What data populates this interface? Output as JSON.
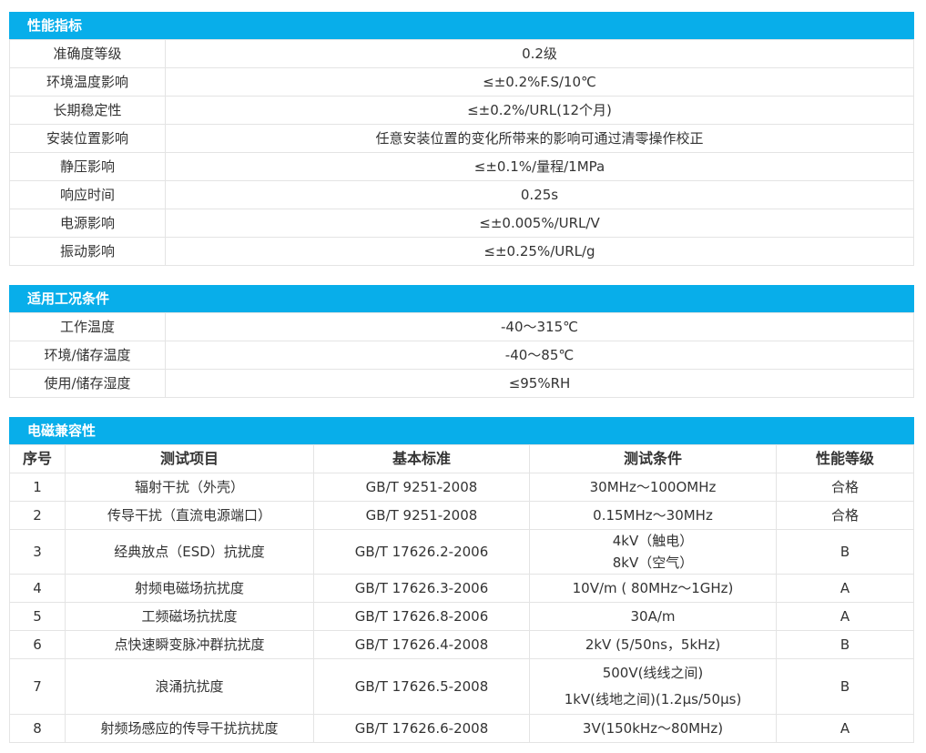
{
  "performance": {
    "title": "性能指标",
    "rows": [
      {
        "label": "准确度等级",
        "value": "0.2级"
      },
      {
        "label": "环境温度影响",
        "value": "≤±0.2%F.S/10℃"
      },
      {
        "label": "长期稳定性",
        "value": "≤±0.2%/URL(12个月)"
      },
      {
        "label": "安装位置影响",
        "value": "任意安装位置的变化所带来的影响可通过清零操作校正"
      },
      {
        "label": "静压影响",
        "value": "≤±0.1%/量程/1MPa"
      },
      {
        "label": "响应时间",
        "value": "0.25s"
      },
      {
        "label": "电源影响",
        "value": "≤±0.005%/URL/V"
      },
      {
        "label": "振动影响",
        "value": "≤±0.25%/URL/g"
      }
    ]
  },
  "conditions": {
    "title": "适用工况条件",
    "rows": [
      {
        "label": "工作温度",
        "value": "-40～315℃"
      },
      {
        "label": "环境/储存温度",
        "value": "-40～85℃"
      },
      {
        "label": "使用/储存湿度",
        "value": "≤95%RH"
      }
    ]
  },
  "emc": {
    "title": "电磁兼容性",
    "headers": [
      "序号",
      "测试项目",
      "基本标准",
      "测试条件",
      "性能等级"
    ],
    "rows": [
      {
        "no": "1",
        "item": "辐射干扰（外壳）",
        "standard": "GB/T 9251-2008",
        "cond": [
          "30MHz～100OMHz"
        ],
        "grade": "合格"
      },
      {
        "no": "2",
        "item": "传导干扰（直流电源端口）",
        "standard": "GB/T 9251-2008",
        "cond": [
          "0.15MHz～30MHz"
        ],
        "grade": "合格"
      },
      {
        "no": "3",
        "item": "经典放点（ESD）抗扰度",
        "standard": "GB/T 17626.2-2006",
        "cond": [
          "4kV（触电）",
          "8kV（空气）"
        ],
        "grade": "B"
      },
      {
        "no": "4",
        "item": "射频电磁场抗扰度",
        "standard": "GB/T 17626.3-2006",
        "cond": [
          "10V/m ( 80MHz～1GHz)"
        ],
        "grade": "A"
      },
      {
        "no": "5",
        "item": "工频磁场抗扰度",
        "standard": "GB/T 17626.8-2006",
        "cond": [
          "30A/m"
        ],
        "grade": "A"
      },
      {
        "no": "6",
        "item": "点快速瞬变脉冲群抗扰度",
        "standard": "GB/T 17626.4-2008",
        "cond": [
          "2kV (5/50ns，5kHz)"
        ],
        "grade": "B"
      },
      {
        "no": "7",
        "item": "浪涌抗扰度",
        "standard": "GB/T 17626.5-2008",
        "cond": [
          "500V(线线之间)",
          "1kV(线地之间)(1.2μs/50μs)"
        ],
        "grade": "B"
      },
      {
        "no": "8",
        "item": "射频场感应的传导干扰抗扰度",
        "standard": "GB/T 17626.6-2008",
        "cond": [
          "3V(150kHz～80MHz)"
        ],
        "grade": "A"
      }
    ]
  }
}
